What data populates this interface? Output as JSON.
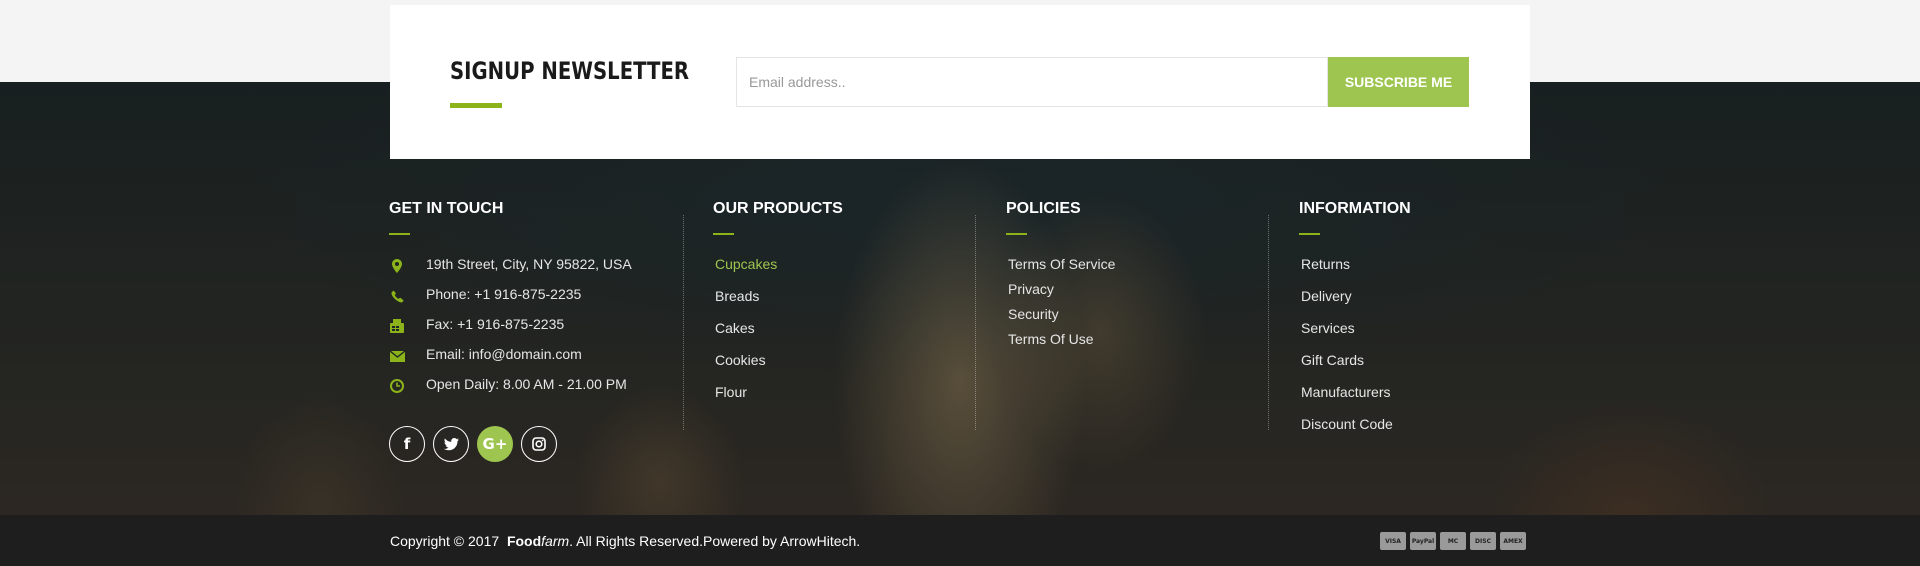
{
  "newsletter": {
    "title": "SIGNUP NEWSLETTER",
    "email_placeholder": "Email address..",
    "button_label": "SUBSCRIBE ME"
  },
  "footer": {
    "contact": {
      "title": "GET IN TOUCH",
      "items": [
        {
          "icon": "map-marker-icon",
          "text": "19th Street, City, NY 95822, USA"
        },
        {
          "icon": "phone-icon",
          "text": "Phone: +1 916-875-2235"
        },
        {
          "icon": "fax-icon",
          "text": "Fax: +1 916-875-2235"
        },
        {
          "icon": "envelope-icon",
          "text": "Email: info@domain.com"
        },
        {
          "icon": "clock-icon",
          "text": "Open Daily: 8.00 AM - 21.00 PM"
        }
      ],
      "socials": [
        {
          "name": "facebook-icon",
          "glyph": "f"
        },
        {
          "name": "twitter-icon",
          "glyph": "t"
        },
        {
          "name": "google-plus-icon",
          "glyph": "G+"
        },
        {
          "name": "instagram-icon",
          "glyph": "ig"
        }
      ]
    },
    "products": {
      "title": "OUR PRODUCTS",
      "links": [
        "Cupcakes",
        "Breads",
        "Cakes",
        "Cookies",
        "Flour"
      ]
    },
    "policies": {
      "title": "POLICIES",
      "links": [
        "Terms Of Service",
        "Privacy",
        "Security",
        "Terms Of Use"
      ]
    },
    "information": {
      "title": "INFORMATION",
      "links": [
        "Returns",
        "Delivery",
        "Services",
        "Gift Cards",
        "Manufacturers",
        "Discount Code"
      ]
    }
  },
  "bottom_bar": {
    "copyright_prefix": "Copyright © 2017",
    "brand_bold": "Food",
    "brand_italic": "farm",
    "copyright_suffix": ". All Rights Reserved.Powered by ArrowHitech.",
    "payments": [
      "VISA",
      "PayPal",
      "MC",
      "DISC",
      "AMEX"
    ]
  },
  "colors": {
    "accent": "#9dc550",
    "accent_dark": "#8cb31a",
    "footer_text": "#e6e6e6",
    "bottom_bar": "#1e1e1e"
  }
}
